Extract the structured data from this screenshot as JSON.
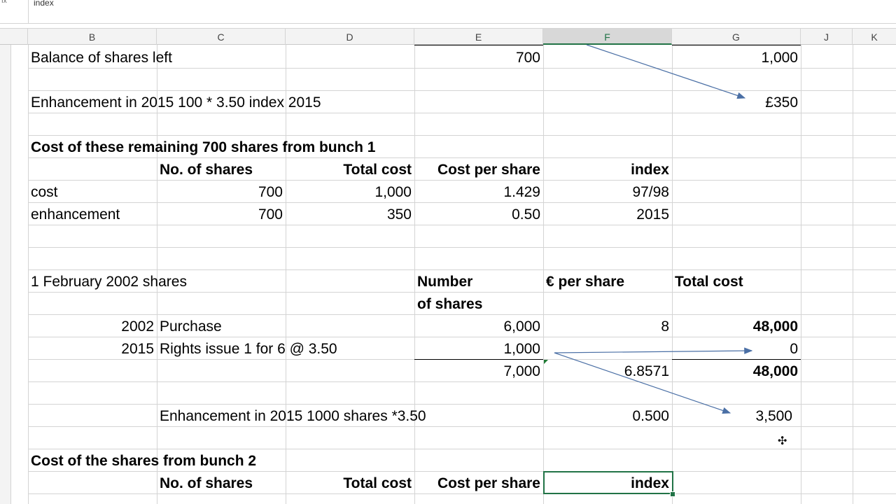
{
  "formula_bar": {
    "fx_label": "fx",
    "content": "index"
  },
  "columns": [
    "B",
    "C",
    "D",
    "E",
    "F",
    "G",
    "J",
    "K"
  ],
  "selected_column": "F",
  "cells": {
    "r1": {
      "label": "Balance of shares left",
      "e": "700",
      "g": "1,000"
    },
    "r3": {
      "label": "Enhancement in 2015  100 * 3.50  index 2015",
      "g": "£350"
    },
    "r5": {
      "title": "Cost of these remaining 700 shares from bunch 1"
    },
    "r6": {
      "c": "No. of shares",
      "d": "Total cost",
      "e": "Cost per share",
      "f": "index"
    },
    "r7": {
      "b": "cost",
      "c": "700",
      "d": "1,000",
      "e": "1.429",
      "f": "97/98"
    },
    "r8": {
      "b": "enhancement",
      "c": "700",
      "d": "350",
      "e": "0.50",
      "f": "2015"
    },
    "r11": {
      "b": "1 February 2002 shares",
      "e": "Number",
      "f": "€ per share",
      "g": "Total cost"
    },
    "r12": {
      "e": "of shares"
    },
    "r13": {
      "b": "2002",
      "c": "Purchase",
      "e": "6,000",
      "f": "8",
      "g": "48,000"
    },
    "r14": {
      "b": "2015",
      "c": "Rights issue 1 for 6 @ 3.50",
      "e": "1,000",
      "g": "0"
    },
    "r15": {
      "e": "7,000",
      "f": "6.8571",
      "g": "48,000"
    },
    "r17": {
      "c": "Enhancement in 2015    1000 shares *3.50",
      "f": "0.500",
      "g": "3,500"
    },
    "r19": {
      "title": "Cost of the shares from bunch 2"
    },
    "r20": {
      "c": "No. of shares",
      "d": "Total cost",
      "e": "Cost per share",
      "f": "index"
    }
  },
  "colors": {
    "grid": "#d4d4d4",
    "selection": "#217346",
    "arrow": "#4a6fa5"
  }
}
